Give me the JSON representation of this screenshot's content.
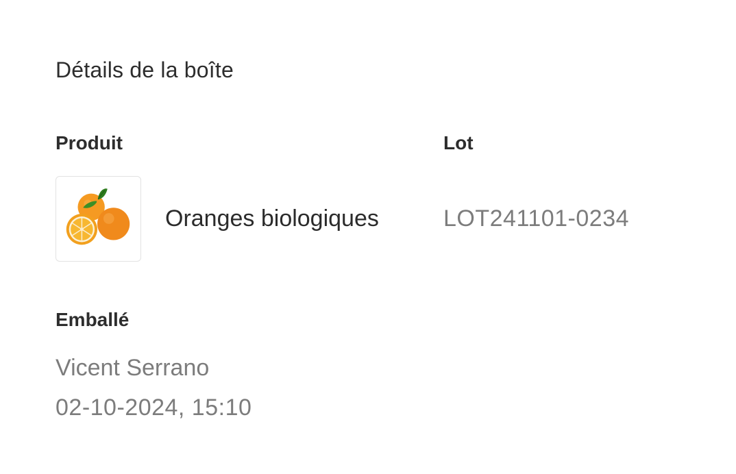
{
  "box_details": {
    "title": "Détails de la boîte",
    "product": {
      "label": "Produit",
      "name": "Oranges biologiques",
      "image_icon": "oranges-image"
    },
    "lot": {
      "label": "Lot",
      "value": "LOT241101-0234"
    },
    "packed": {
      "label": "Emballé",
      "by": "Vicent Serrano",
      "at": "02-10-2024, 15:10"
    }
  },
  "colors": {
    "heading_text": "#2d2d2d",
    "muted_text": "#7c7c7c",
    "thumb_border": "#e2e2e2",
    "orange": "#f08a1c"
  }
}
